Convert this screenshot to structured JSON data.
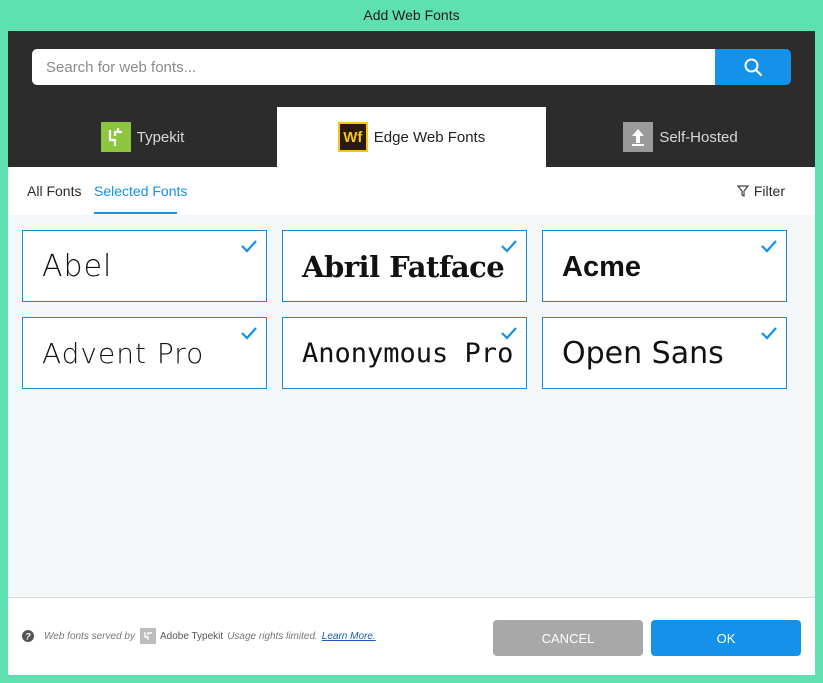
{
  "window": {
    "title": "Add Web Fonts"
  },
  "search": {
    "placeholder": "Search for web fonts..."
  },
  "source_tabs": [
    {
      "label": "Typekit",
      "icon": "typekit-icon",
      "active": false
    },
    {
      "label": "Edge Web Fonts",
      "icon": "edge-web-fonts-icon",
      "active": true
    },
    {
      "label": "Self-Hosted",
      "icon": "upload-icon",
      "active": false
    }
  ],
  "filter_tabs": {
    "all_label": "All Fonts",
    "selected_label": "Selected Fonts",
    "active": "selected"
  },
  "filter": {
    "label": "Filter"
  },
  "fonts": [
    {
      "name": "Abel",
      "selected": true
    },
    {
      "name": "Abril Fatface",
      "selected": true
    },
    {
      "name": "Acme",
      "selected": true
    },
    {
      "name": "Advent Pro",
      "selected": true
    },
    {
      "name": "Anonymous Pro",
      "selected": true
    },
    {
      "name": "Open Sans",
      "selected": true
    }
  ],
  "footer": {
    "credit_prefix": "Web fonts served by",
    "credit_brand": "Adobe Typekit",
    "credit_suffix": "Usage rights limited.",
    "learn_more": "Learn More.",
    "cancel_label": "CANCEL",
    "ok_label": "OK"
  },
  "colors": {
    "accent": "#1491e8",
    "window_frame": "#5ee0b0",
    "header_bg": "#2c2c2c",
    "typekit_green": "#8cc63f",
    "edge_yellow": "#f5c518"
  },
  "tab_logos": {
    "edge": "Wf"
  }
}
